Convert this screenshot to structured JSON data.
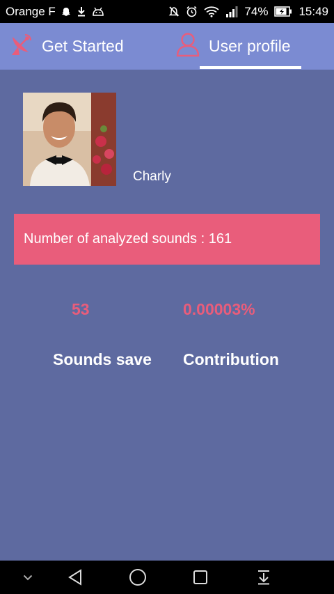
{
  "status_bar": {
    "carrier": "Orange F",
    "battery": "74%",
    "time": "15:49",
    "icons": [
      "snapchat-icon",
      "download-icon",
      "android-icon",
      "mute-icon",
      "alarm-icon",
      "wifi-icon",
      "signal-icon",
      "battery-icon"
    ]
  },
  "tabs": [
    {
      "label": "Get Started",
      "icon": "satellite-dish-icon",
      "active": false
    },
    {
      "label": "User profile",
      "icon": "user-icon",
      "active": true
    }
  ],
  "profile": {
    "name": "Charly"
  },
  "banner": {
    "text": "Number of analyzed sounds : 161"
  },
  "stats": [
    {
      "value": "53",
      "label": "Sounds save"
    },
    {
      "value": "0.00003%",
      "label": "Contribution"
    }
  ],
  "nav_bar": {
    "buttons": [
      "hide-keyboard-icon",
      "back-icon",
      "home-icon",
      "recents-icon",
      "notifications-pull-icon"
    ]
  },
  "colors": {
    "background": "#5e6aa0",
    "tab_bar": "#7b8bd2",
    "accent": "#e95d7b"
  }
}
